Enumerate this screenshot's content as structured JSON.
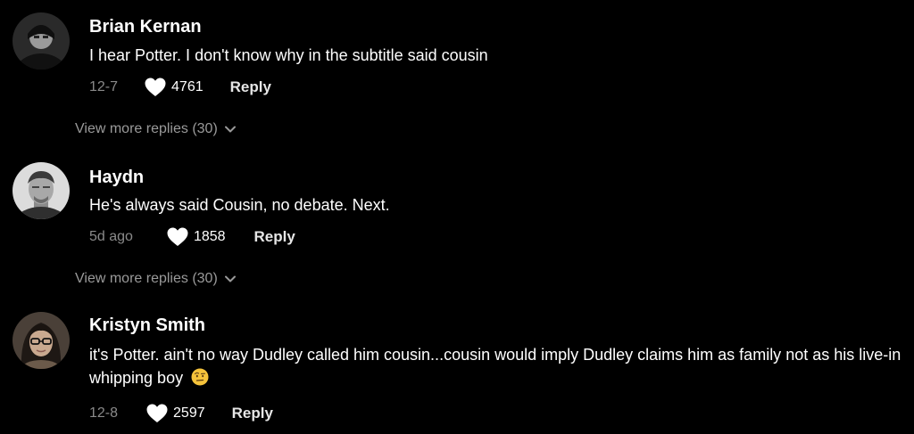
{
  "comments": [
    {
      "author": "Brian Kernan",
      "text": "I hear Potter. I don't know why in the subtitle said cousin",
      "date": "12-7",
      "likes": "4761",
      "reply_label": "Reply",
      "view_more": "View more replies (30)",
      "avatar_icon": "avatar-dark-hooded-person"
    },
    {
      "author": "Haydn",
      "text": "He's always said Cousin, no debate. Next.",
      "date": "5d ago",
      "likes": "1858",
      "reply_label": "Reply",
      "view_more": "View more replies (30)",
      "avatar_icon": "avatar-man-photo"
    },
    {
      "author": "Kristyn Smith",
      "text": "it's Potter. ain't no way Dudley called him cousin...cousin would imply Dudley claims him as family not as his live-in whipping boy",
      "date": "12-8",
      "likes": "2597",
      "reply_label": "Reply",
      "emoji": "face-with-raised-eyebrow-emoji",
      "avatar_icon": "avatar-woman-glasses-photo"
    }
  ],
  "colors": {
    "background": "#000000",
    "text": "#ffffff",
    "muted": "#8a8a8a",
    "view_more": "#9a9a9a"
  }
}
